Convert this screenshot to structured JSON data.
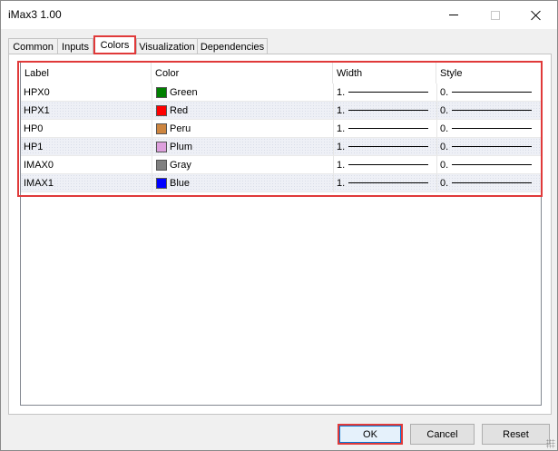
{
  "window": {
    "title": "iMax3 1.00"
  },
  "tabs": [
    {
      "label": "Common"
    },
    {
      "label": "Inputs"
    },
    {
      "label": "Colors"
    },
    {
      "label": "Visualization"
    },
    {
      "label": "Dependencies"
    }
  ],
  "table": {
    "columns": [
      "Label",
      "Color",
      "Width",
      "Style"
    ],
    "rows": [
      {
        "label": "HPX0",
        "color_name": "Green",
        "color_hex": "#008000",
        "width": "1.",
        "style": "0."
      },
      {
        "label": "HPX1",
        "color_name": "Red",
        "color_hex": "#ff0000",
        "width": "1.",
        "style": "0."
      },
      {
        "label": "HP0",
        "color_name": "Peru",
        "color_hex": "#cd853f",
        "width": "1.",
        "style": "0."
      },
      {
        "label": "HP1",
        "color_name": "Plum",
        "color_hex": "#dda0dd",
        "width": "1.",
        "style": "0."
      },
      {
        "label": "IMAX0",
        "color_name": "Gray",
        "color_hex": "#808080",
        "width": "1.",
        "style": "0."
      },
      {
        "label": "IMAX1",
        "color_name": "Blue",
        "color_hex": "#0000ff",
        "width": "1.",
        "style": "0."
      }
    ]
  },
  "buttons": {
    "ok": "OK",
    "cancel": "Cancel",
    "reset": "Reset"
  },
  "colors": {
    "highlight": "#e03a3a",
    "accent": "#0078d7"
  }
}
